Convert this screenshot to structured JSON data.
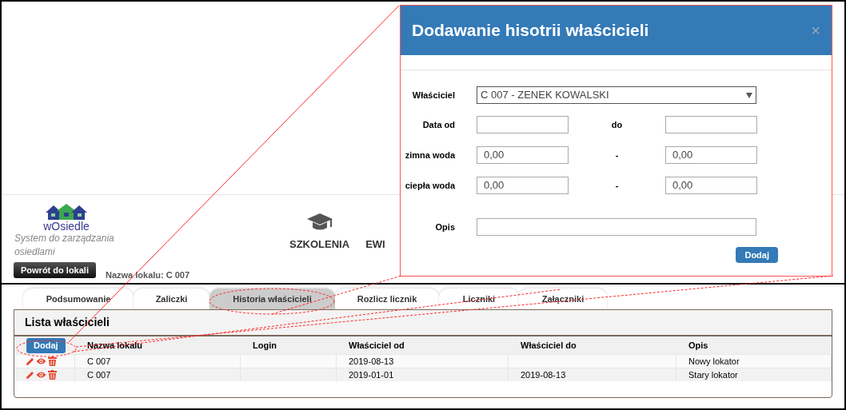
{
  "app": {
    "logo_text": "wOsiedle",
    "tagline": "System do zarządzania osiedlami"
  },
  "nav": [
    {
      "label": "SZKOLENIA",
      "kind": "cap"
    },
    {
      "label": "EWI",
      "kind": "plain"
    }
  ],
  "back_button": "Powrót do lokali",
  "unit_label": "Nazwa lokalu: C 007",
  "tabs": [
    {
      "label": "Podsumowanie",
      "selected": false
    },
    {
      "label": "Zaliczki",
      "selected": false
    },
    {
      "label": "Historia właścicieli",
      "selected": true
    },
    {
      "label": "Rozlicz licznik",
      "selected": false
    },
    {
      "label": "Liczniki",
      "selected": false
    },
    {
      "label": "Załączniki",
      "selected": false
    }
  ],
  "panel": {
    "title": "Lista właścicieli",
    "add_button": "Dodaj",
    "columns": [
      "Nazwa lokalu",
      "Login",
      "Właściciel od",
      "Właściciel do",
      "Opis"
    ],
    "rows": [
      {
        "cells": [
          "C 007",
          "",
          "2019-08-13",
          "",
          "Nowy lokator"
        ]
      },
      {
        "cells": [
          "C 007",
          "",
          "2019-01-01",
          "2019-08-13",
          "Stary lokator"
        ]
      }
    ]
  },
  "modal": {
    "title": "Dodawanie hisotrii właścicieli",
    "close": "×",
    "submit": "Dodaj",
    "fields": [
      {
        "label": "Właściciel",
        "kind": "select",
        "value": "C 007 - ZENEK KOWALSKI"
      },
      {
        "label": "Data od",
        "kind": "range",
        "separator": "do"
      },
      {
        "label": "zimna woda",
        "kind": "range",
        "separator": "-",
        "from": "0,00",
        "to": "0,00"
      },
      {
        "label": "ciepła woda",
        "kind": "range",
        "separator": "-",
        "from": "0,00",
        "to": "0,00"
      },
      {
        "label": "Opis",
        "kind": "text"
      }
    ]
  }
}
